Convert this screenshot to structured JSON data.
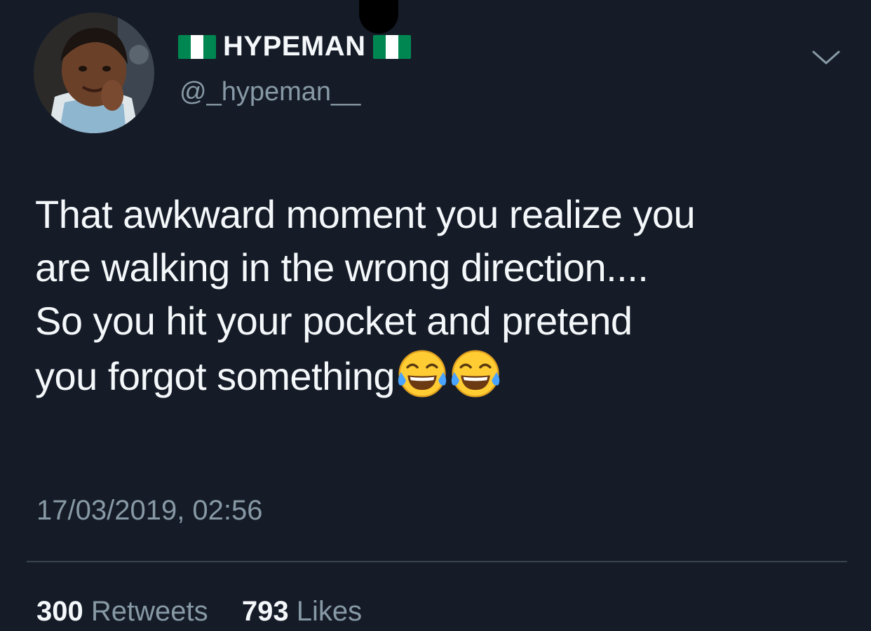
{
  "tweet": {
    "display_name": "HYPEMAN",
    "handle": "@_hypeman__",
    "text_lines": [
      "That awkward moment you realize you",
      "are walking in the wrong direction....",
      "So you hit your pocket and pretend",
      "you forgot something"
    ],
    "emoji": "face-with-tears-of-joy-emoji",
    "emoji_count": 2,
    "timestamp": "17/03/2019, 02:56",
    "retweets_count": "300",
    "retweets_label": "Retweets",
    "likes_count": "793",
    "likes_label": "Likes"
  },
  "icons": {
    "name_flags": "nigeria-flag-icon",
    "menu": "chevron-down-icon"
  },
  "colors": {
    "background": "#151c28",
    "primary_text": "#f5f8fa",
    "secondary_text": "#8899a6",
    "divider": "#38444d",
    "flag_green": "#008751"
  }
}
